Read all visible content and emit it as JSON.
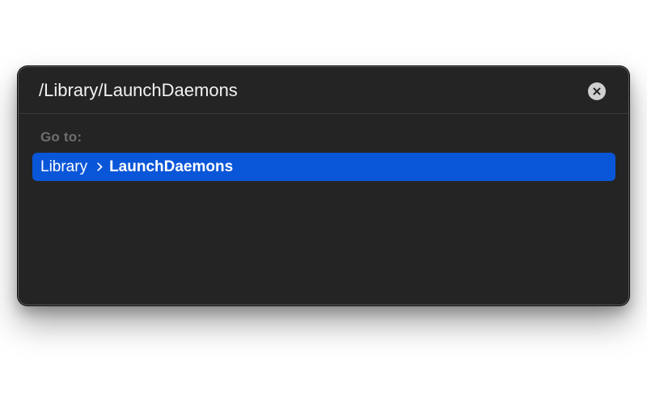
{
  "goto_dialog": {
    "path_value": "/Library/LaunchDaemons",
    "clear_icon": "xmark-circle-icon",
    "section_label": "Go to:",
    "results": [
      {
        "parent": "Library",
        "separator_icon": "chevron-right-icon",
        "name": "LaunchDaemons",
        "selected": true
      }
    ]
  },
  "colors": {
    "dialog_bg": "#242424",
    "selection": "#0a56d8",
    "section_label": "#6e6e6e",
    "clear_button": "#cfcfcf"
  }
}
